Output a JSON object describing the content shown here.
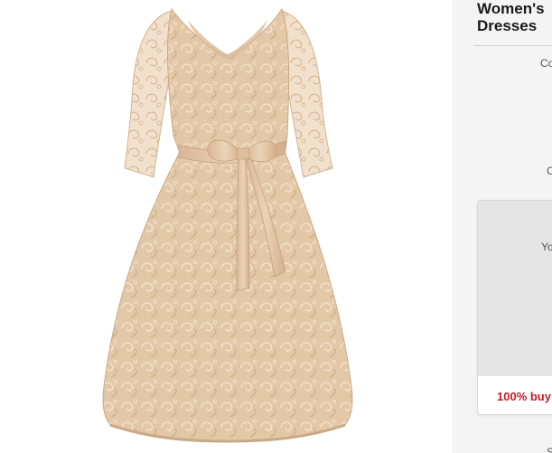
{
  "product": {
    "title_line1": "Women's",
    "title_line2": "Dresses",
    "image_alt": "Lace A-line dress with three-quarter sleeves and satin bow belt"
  },
  "sidebar": {
    "label_co": "Co",
    "label_c": "C",
    "label_yo": "Yo",
    "label_s": "S"
  },
  "offer_card": {
    "guarantee_text": "100% buy"
  },
  "colors": {
    "dress": "#e3c8a8",
    "accent_red": "#c31b27"
  }
}
